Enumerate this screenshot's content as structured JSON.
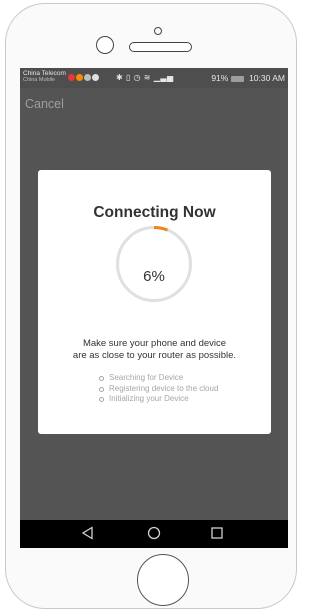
{
  "status_bar": {
    "carrier_primary": "China Telecom",
    "carrier_secondary": "China Mobile",
    "signal_info": "ᴴ⸗⸗⸗ ᴴᴰ⸗⸗",
    "battery_percent": "91%",
    "time": "10:30 AM"
  },
  "header": {
    "cancel_label": "Cancel"
  },
  "dialog": {
    "title": "Connecting Now",
    "progress_percent_label": "6%",
    "progress_fraction": 0.06,
    "accent_color": "#f0871e",
    "track_color": "#e0e0e0",
    "message_line1": "Make sure your phone and device",
    "message_line2": "are as close to your router as possible.",
    "steps": [
      "Searching for Device",
      "Registering device to the cloud",
      "Initializing your Device"
    ]
  },
  "nav_bar": {
    "icons": [
      "back-icon",
      "home-icon",
      "recent-apps-icon"
    ]
  },
  "colors": {
    "overlay": "#545454",
    "dialog_bg": "#ffffff",
    "nav_bg": "#000000"
  }
}
